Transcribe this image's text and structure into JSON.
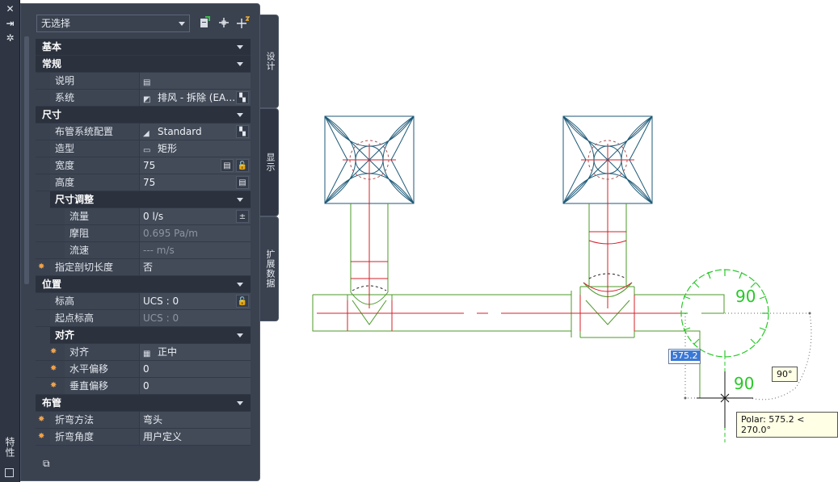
{
  "palette": {
    "selection": "无选择",
    "strip_title": "特性",
    "tabs": [
      "设计",
      "显示",
      "扩展数据"
    ],
    "categories": {
      "basic": "基本",
      "general": "常规",
      "dimensions": "尺寸",
      "size_adjust": "尺寸调整",
      "location": "位置",
      "justify": "对齐",
      "routing": "布管"
    },
    "props": {
      "description": {
        "name": "说明",
        "value": ""
      },
      "system": {
        "name": "系统",
        "value": "排风 - 拆除 (EA…"
      },
      "routing_pref": {
        "name": "布管系统配置",
        "value": "Standard"
      },
      "shape": {
        "name": "造型",
        "value": "矩形"
      },
      "width": {
        "name": "宽度",
        "value": "75"
      },
      "height": {
        "name": "高度",
        "value": "75"
      },
      "flow": {
        "name": "流量",
        "value": "0 l/s"
      },
      "friction": {
        "name": "摩阻",
        "value": "0.695 Pa/m"
      },
      "velocity": {
        "name": "流速",
        "value": "--- m/s"
      },
      "cut_length": {
        "name": "指定剖切长度",
        "value": "否"
      },
      "elevation": {
        "name": "标高",
        "value": "UCS : 0"
      },
      "start_elevation": {
        "name": "起点标高",
        "value": "UCS : 0"
      },
      "justify": {
        "name": "对齐",
        "value": "正中"
      },
      "h_offset": {
        "name": "水平偏移",
        "value": "0"
      },
      "v_offset": {
        "name": "垂直偏移",
        "value": "0"
      },
      "bend_method": {
        "name": "折弯方法",
        "value": "弯头"
      },
      "bend_angle": {
        "name": "折弯角度",
        "value": "用户定义"
      }
    }
  },
  "drawing": {
    "dyn_input": "575.2",
    "angle_tip": "90°",
    "polar_tip": "Polar: 575.2 < 270.0°",
    "angle_label_top": "90",
    "angle_label_bottom": "90"
  },
  "colors": {
    "panel_bg": "#3a4250",
    "category_bg": "#2b313d",
    "duct_green": "#4c9a2a",
    "centerline_red": "#d4202a",
    "diffuser_blue": "#1e5a78",
    "tracking_green": "#28c828",
    "highlight_blue": "#3a78d6"
  }
}
